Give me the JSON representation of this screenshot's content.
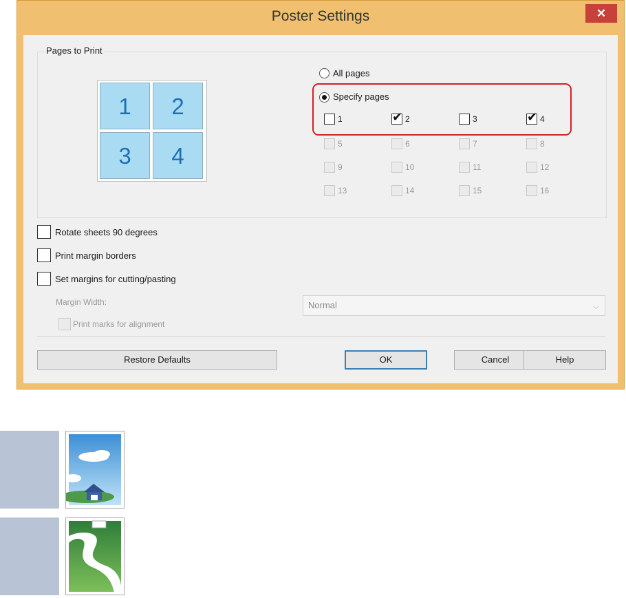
{
  "dialog": {
    "title": "Poster Settings",
    "close_glyph": "✕"
  },
  "pages_to_print": {
    "label": "Pages to Print",
    "preview_tiles": [
      "1",
      "2",
      "3",
      "4"
    ],
    "all_pages_label": "All pages",
    "specify_pages_label": "Specify pages",
    "selected_mode": "specify",
    "pages": [
      {
        "label": "1",
        "checked": false,
        "enabled": true
      },
      {
        "label": "2",
        "checked": true,
        "enabled": true
      },
      {
        "label": "3",
        "checked": false,
        "enabled": true
      },
      {
        "label": "4",
        "checked": true,
        "enabled": true
      },
      {
        "label": "5",
        "checked": false,
        "enabled": false
      },
      {
        "label": "6",
        "checked": false,
        "enabled": false
      },
      {
        "label": "7",
        "checked": false,
        "enabled": false
      },
      {
        "label": "8",
        "checked": false,
        "enabled": false
      },
      {
        "label": "9",
        "checked": false,
        "enabled": false
      },
      {
        "label": "10",
        "checked": false,
        "enabled": false
      },
      {
        "label": "11",
        "checked": false,
        "enabled": false
      },
      {
        "label": "12",
        "checked": false,
        "enabled": false
      },
      {
        "label": "13",
        "checked": false,
        "enabled": false
      },
      {
        "label": "14",
        "checked": false,
        "enabled": false
      },
      {
        "label": "15",
        "checked": false,
        "enabled": false
      },
      {
        "label": "16",
        "checked": false,
        "enabled": false
      }
    ],
    "highlight_color": "#d32028"
  },
  "options": {
    "rotate_label": "Rotate sheets 90 degrees",
    "margin_borders_label": "Print margin borders",
    "cutting_label": "Set margins for cutting/pasting",
    "margin_width_label": "Margin Width:",
    "margin_width_value": "Normal",
    "alignment_marks_label": "Print marks for alignment"
  },
  "buttons": {
    "restore_defaults": "Restore Defaults",
    "ok": "OK",
    "cancel": "Cancel",
    "help": "Help"
  },
  "colors": {
    "title_bar": "#f0c070",
    "close_button": "#c7413b",
    "tile_fill": "#a9dcf3",
    "tile_text": "#1f6fb8"
  }
}
